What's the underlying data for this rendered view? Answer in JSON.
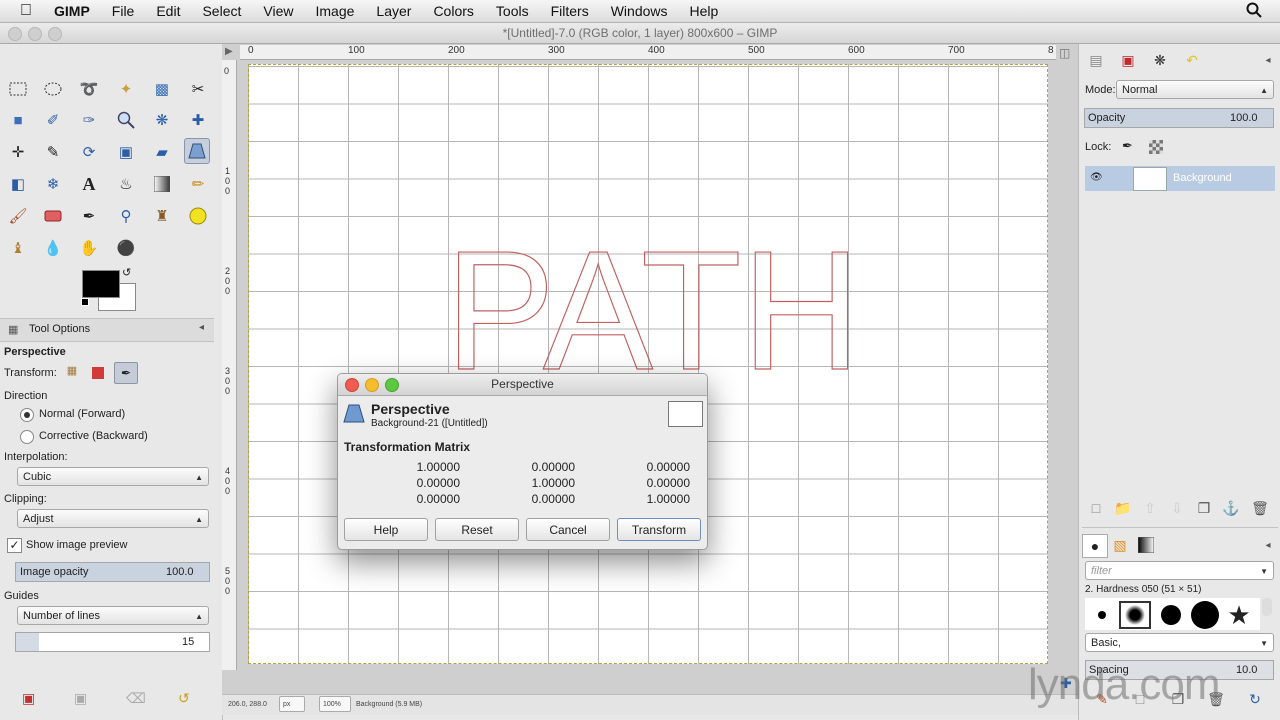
{
  "menubar": {
    "app": "GIMP",
    "items": [
      "File",
      "Edit",
      "Select",
      "View",
      "Image",
      "Layer",
      "Colors",
      "Tools",
      "Filters",
      "Windows",
      "Help"
    ]
  },
  "window": {
    "title": "*[Untitled]-7.0 (RGB color, 1 layer) 800x600 – GIMP"
  },
  "rulers": {
    "h_ticks": [
      "0",
      "100",
      "200",
      "300",
      "400",
      "500",
      "600",
      "700",
      "8"
    ],
    "v_ticks": [
      "0",
      "1\n0\n0",
      "2\n0\n0",
      "3\n0\n0",
      "4\n0\n0",
      "5\n0\n0"
    ]
  },
  "canvas": {
    "text": "PATH"
  },
  "tool_options": {
    "tab_label": "Tool Options",
    "tool_name": "Perspective",
    "transform_label": "Transform:",
    "direction_label": "Direction",
    "direction_normal": "Normal (Forward)",
    "direction_corrective": "Corrective (Backward)",
    "interpolation_label": "Interpolation:",
    "interpolation_value": "Cubic",
    "clipping_label": "Clipping:",
    "clipping_value": "Adjust",
    "show_preview_label": "Show image preview",
    "image_opacity_label": "Image opacity",
    "image_opacity_value": "100.0",
    "guides_label": "Guides",
    "guides_value": "Number of lines",
    "guides_count": "15"
  },
  "dialog": {
    "title": "Perspective",
    "heading": "Perspective",
    "subheading": "Background-21 ([Untitled])",
    "matrix_label": "Transformation Matrix",
    "matrix": [
      [
        "1.00000",
        "0.00000",
        "0.00000"
      ],
      [
        "0.00000",
        "1.00000",
        "0.00000"
      ],
      [
        "0.00000",
        "0.00000",
        "1.00000"
      ]
    ],
    "buttons": {
      "help": "Help",
      "reset": "Reset",
      "cancel": "Cancel",
      "transform": "Transform"
    }
  },
  "layers": {
    "mode_label": "Mode:",
    "mode_value": "Normal",
    "opacity_label": "Opacity",
    "opacity_value": "100.0",
    "lock_label": "Lock:",
    "layer_name": "Background"
  },
  "brushes": {
    "filter_placeholder": "filter",
    "brush_name": "2. Hardness 050 (51 × 51)",
    "tag_value": "Basic,",
    "spacing_label": "Spacing",
    "spacing_value": "10.0"
  },
  "statusbar": {
    "coords": "206.0, 288.0",
    "unit": "px",
    "zoom": "100%",
    "layer_info": "Background (5.9 MB)"
  },
  "watermark": "lynda.com"
}
